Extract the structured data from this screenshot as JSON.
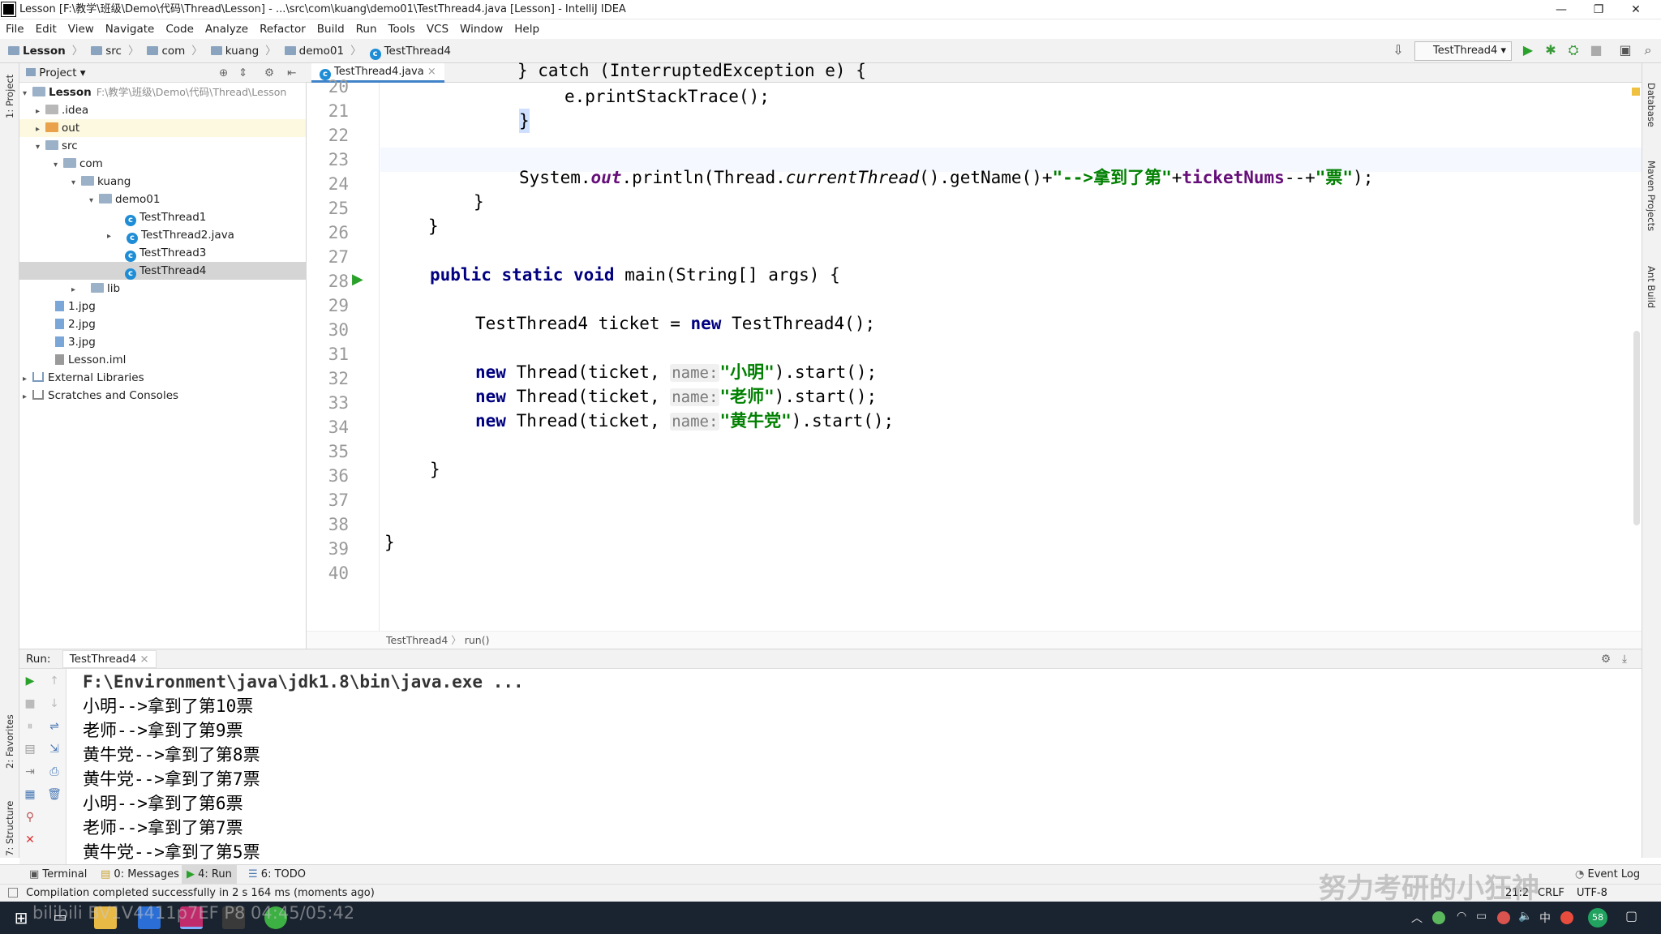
{
  "window": {
    "title": "Lesson [F:\\教学\\班级\\Demo\\代码\\Thread\\Lesson] - ...\\src\\com\\kuang\\demo01\\TestThread4.java [Lesson] - IntelliJ IDEA"
  },
  "menu": [
    "File",
    "Edit",
    "View",
    "Navigate",
    "Code",
    "Analyze",
    "Refactor",
    "Build",
    "Run",
    "Tools",
    "VCS",
    "Window",
    "Help"
  ],
  "breadcrumb": [
    "Lesson",
    "src",
    "com",
    "kuang",
    "demo01",
    "TestThread4"
  ],
  "run_config": "TestThread4",
  "side_tabs": {
    "project": "1: Project",
    "favorites": "2: Favorites",
    "structure": "7: Structure",
    "database": "Database",
    "maven": "Maven Projects",
    "ant": "Ant Build"
  },
  "project": {
    "header": "Project",
    "root_name": "Lesson",
    "root_path": "F:\\教学\\班级\\Demo\\代码\\Thread\\Lesson",
    "items": [
      ".idea",
      "out",
      "src",
      "com",
      "kuang",
      "demo01",
      "TestThread1",
      "TestThread2.java",
      "TestThread3",
      "TestThread4",
      "lib",
      "1.jpg",
      "2.jpg",
      "3.jpg",
      "Lesson.iml",
      "External Libraries",
      "Scratches and Consoles"
    ]
  },
  "editor": {
    "tab": "TestThread4.java",
    "line_numbers": [
      "20",
      "21",
      "22",
      "23",
      "24",
      "25",
      "26",
      "27",
      "28",
      "29",
      "30",
      "31",
      "32",
      "33",
      "34",
      "35",
      "36",
      "37",
      "38",
      "39",
      "40"
    ],
    "l20": "} catch (InterruptedException e) {",
    "l21": "e.printStackTrace();",
    "l22": "}",
    "l24a": "System.",
    "l24b": "out",
    "l24c": ".println(Thread.",
    "l24d": "currentThread",
    "l24e": "().getName()+",
    "l24f": "\"-->拿到了第\"",
    "l24g": "+",
    "l24h": "ticketNums",
    "l24i": "--+",
    "l24j": "\"票\"",
    "l24k": ");",
    "l25": "}",
    "l26": "}",
    "l28kw": "public static void",
    "l28": " main(String[] args) {",
    "l30a": "TestThread4 ticket = ",
    "kw_new": "new",
    "l30b": " TestThread4();",
    "l32a": " Thread(ticket, ",
    "hint": "name:",
    "l32s": "\"小明\"",
    "l32b": ").start();",
    "l33s": "\"老师\"",
    "l34s": "\"黄牛党\"",
    "l36": "}",
    "l39": "}",
    "crumbs": [
      "TestThread4",
      "run()"
    ]
  },
  "run": {
    "label": "Run:",
    "tab": "TestThread4",
    "lines": [
      "F:\\Environment\\java\\jdk1.8\\bin\\java.exe ...",
      "小明-->拿到了第10票",
      "老师-->拿到了第9票",
      "黄牛党-->拿到了第8票",
      "黄牛党-->拿到了第7票",
      "小明-->拿到了第6票",
      "老师-->拿到了第7票",
      "黄牛党-->拿到了第5票"
    ]
  },
  "bottom_tabs": [
    "Terminal",
    "0: Messages",
    "4: Run",
    "6: TODO",
    "Event Log"
  ],
  "status": {
    "message": "Compilation completed successfully in 2 s 164 ms (moments ago)",
    "right": [
      "21:2",
      "CRLF",
      "UTF-8"
    ]
  },
  "overlay": {
    "video": "bilibili BV1V4411p7EF P8 04:45/05:42",
    "watermark": "努力考研的小狂神"
  },
  "taskbar": {
    "tray_temp": "58"
  }
}
